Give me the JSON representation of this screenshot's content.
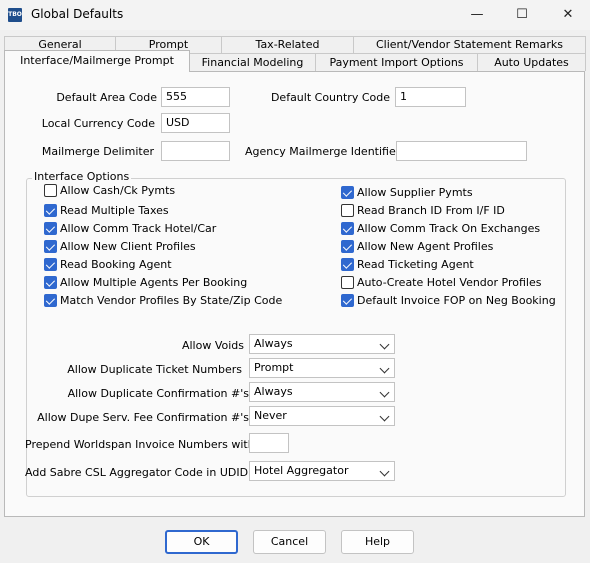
{
  "window": {
    "title": "Global Defaults",
    "icon_text": "TBO",
    "minimize": "—",
    "maximize": "☐",
    "close": "✕"
  },
  "tabs": {
    "row1": [
      "General",
      "Prompt",
      "Tax-Related",
      "Client/Vendor Statement Remarks"
    ],
    "row2": [
      "Interface/Mailmerge Prompt",
      "Financial Modeling",
      "Payment Import Options",
      "Auto Updates"
    ],
    "active": "Interface/Mailmerge Prompt"
  },
  "fields": {
    "default_area_code": {
      "label": "Default Area Code",
      "value": "555"
    },
    "default_country_code": {
      "label": "Default Country Code",
      "value": "1"
    },
    "local_currency_code": {
      "label": "Local Currency Code",
      "value": "USD"
    },
    "mailmerge_delimiter": {
      "label": "Mailmerge Delimiter",
      "value": ""
    },
    "agency_mailmerge_identifier": {
      "label": "Agency Mailmerge Identifier",
      "value": ""
    }
  },
  "interface_options": {
    "title": "Interface Options",
    "left": [
      {
        "label": "Allow Cash/Ck Pymts",
        "checked": false
      },
      {
        "label": "Read Multiple Taxes",
        "checked": true
      },
      {
        "label": "Allow Comm Track Hotel/Car",
        "checked": true
      },
      {
        "label": "Allow New Client Profiles",
        "checked": true
      },
      {
        "label": "Read Booking Agent",
        "checked": true
      },
      {
        "label": "Allow Multiple Agents Per Booking",
        "checked": true
      },
      {
        "label": "Match Vendor Profiles By State/Zip Code",
        "checked": true
      }
    ],
    "right": [
      {
        "label": "Allow Supplier Pymts",
        "checked": true
      },
      {
        "label": "Read Branch ID From I/F ID",
        "checked": false
      },
      {
        "label": "Allow Comm Track On Exchanges",
        "checked": true
      },
      {
        "label": "Allow New Agent Profiles",
        "checked": true
      },
      {
        "label": "Read Ticketing Agent",
        "checked": true
      },
      {
        "label": "Auto-Create Hotel Vendor Profiles",
        "checked": false
      },
      {
        "label": "Default Invoice FOP on Neg Booking",
        "checked": true
      }
    ],
    "allow_voids": {
      "label": "Allow Voids",
      "value": "Always"
    },
    "allow_duplicate_ticket_numbers": {
      "label": "Allow Duplicate Ticket Numbers",
      "value": "Prompt"
    },
    "allow_duplicate_confirmation": {
      "label": "Allow Duplicate Confirmation #'s",
      "value": "Always"
    },
    "allow_dupe_serv_fee_confirmation": {
      "label": "Allow Dupe Serv. Fee Confirmation #'s",
      "value": "Never"
    },
    "prepend_worldspan": {
      "label": "Prepend Worldspan Invoice Numbers with",
      "value": ""
    },
    "add_sabre_csl": {
      "label": "Add Sabre CSL Aggregator Code in UDID",
      "value": "Hotel Aggregator"
    }
  },
  "buttons": {
    "ok": "OK",
    "cancel": "Cancel",
    "help": "Help"
  },
  "colors": {
    "accent": "#2f68cf",
    "background": "#f0f0f0",
    "page": "#fafafa"
  }
}
